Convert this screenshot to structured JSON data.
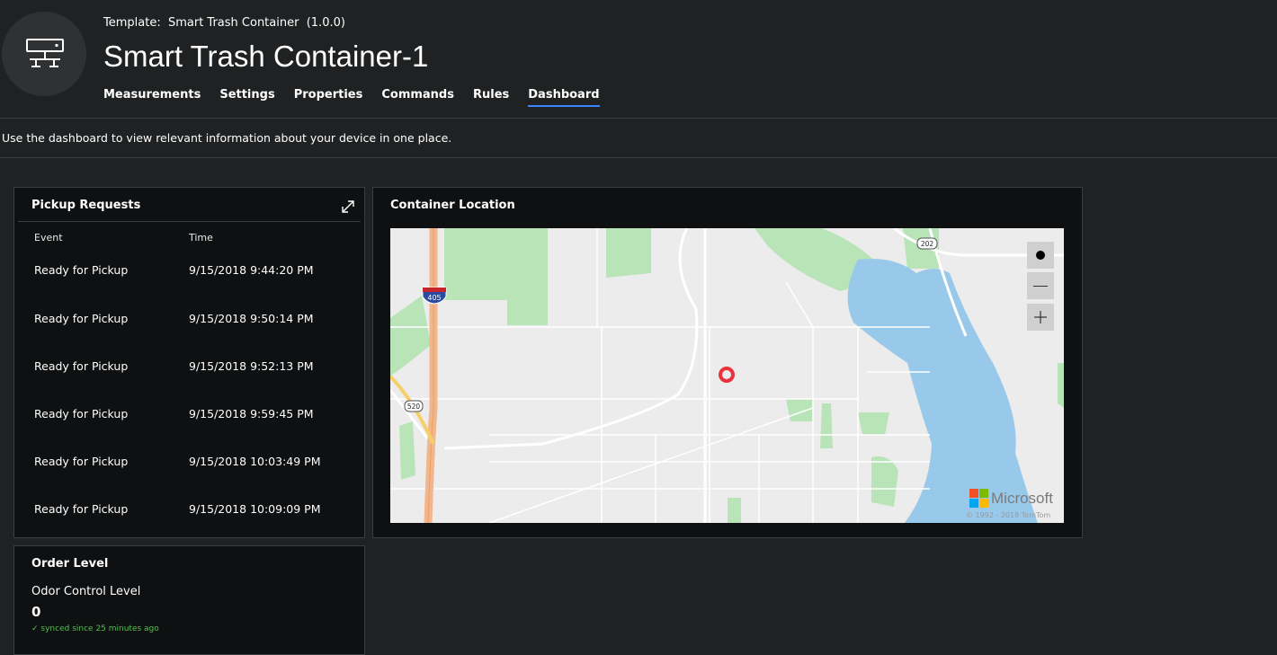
{
  "device": {
    "template_prefix": "Template:",
    "template_name": "Smart Trash Container",
    "template_version": "(1.0.0)",
    "title": "Smart Trash Container-1",
    "icon": "device-network-icon"
  },
  "tabs": [
    {
      "label": "Measurements"
    },
    {
      "label": "Settings"
    },
    {
      "label": "Properties"
    },
    {
      "label": "Commands"
    },
    {
      "label": "Rules"
    },
    {
      "label": "Dashboard",
      "active": true
    }
  ],
  "description": "Use the dashboard to view relevant information about your device in one place.",
  "pickup": {
    "title": "Pickup Requests",
    "columns": [
      "Event",
      "Time"
    ],
    "rows": [
      {
        "event": "Ready for Pickup",
        "time": "9/15/2018 9:44:20 PM"
      },
      {
        "event": "Ready for Pickup",
        "time": "9/15/2018 9:50:14 PM"
      },
      {
        "event": "Ready for Pickup",
        "time": "9/15/2018 9:52:13 PM"
      },
      {
        "event": "Ready for Pickup",
        "time": "9/15/2018 9:59:45 PM"
      },
      {
        "event": "Ready for Pickup",
        "time": "9/15/2018 10:03:49 PM"
      },
      {
        "event": "Ready for Pickup",
        "time": "9/15/2018 10:09:09 PM"
      }
    ]
  },
  "location": {
    "title": "Container Location",
    "map": {
      "road_labels": [
        "405",
        "520",
        "202"
      ],
      "brand": "Microsoft",
      "copyright": "© 1992 - 2018 TomTom"
    }
  },
  "order": {
    "title": "Order Level",
    "label": "Odor Control Level",
    "value": "0",
    "sync": "synced since 25 minutes ago"
  },
  "colors": {
    "background": "#1f2122",
    "tile": "#0f1011",
    "accent": "#3b86ff",
    "sync_green": "#52c152",
    "water": "#99c9ea",
    "park": "#b0e0b0",
    "pin": "#e8323c"
  }
}
